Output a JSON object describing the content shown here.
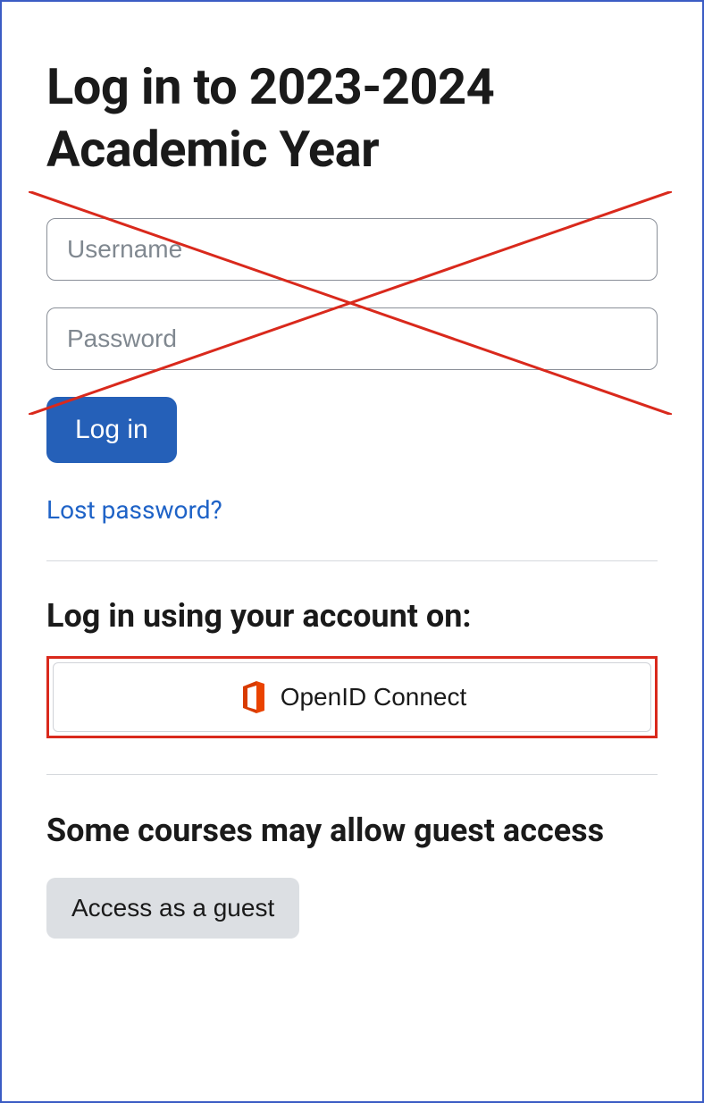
{
  "title": "Log in to 2023-2024 Academic Year",
  "form": {
    "username_placeholder": "Username",
    "password_placeholder": "Password",
    "login_button": "Log in",
    "lost_password": "Lost password?"
  },
  "sso": {
    "heading": "Log in using your account on:",
    "openid_label": "OpenID Connect"
  },
  "guest": {
    "heading": "Some courses may allow guest access",
    "button": "Access as a guest"
  },
  "annotations": {
    "cross_color": "#d9291c",
    "highlight_color": "#d9291c"
  }
}
